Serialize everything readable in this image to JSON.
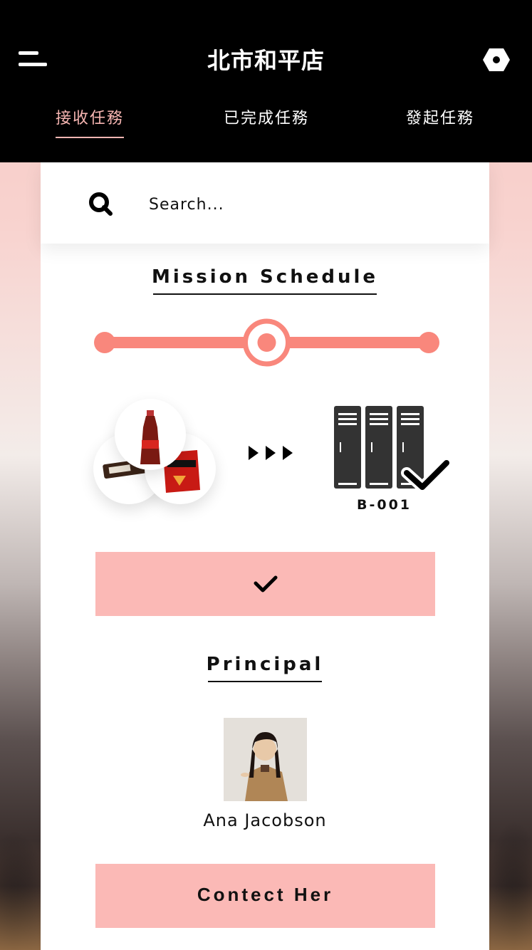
{
  "header": {
    "store_name": "北市和平店"
  },
  "tabs": [
    {
      "label": "接收任務",
      "active": true
    },
    {
      "label": "已完成任務",
      "active": false
    },
    {
      "label": "發起任務",
      "active": false
    }
  ],
  "search": {
    "placeholder": "Search..."
  },
  "mission": {
    "title": "Mission Schedule",
    "progress_value": 0.5,
    "locker_id": "B-001"
  },
  "principal": {
    "title": "Principal",
    "name": "Ana Jacobson",
    "contact_label": "Contect Her"
  },
  "colors": {
    "accent": "#fbb9b6",
    "slider": "#f9877c",
    "header_bg": "#000000",
    "card_bg": "#ffffff"
  },
  "icons": {
    "menu": "menu-icon",
    "settings": "settings-icon",
    "search": "search-icon",
    "check": "check-icon",
    "arrows": "forward-arrows-icon",
    "locker": "locker-icon"
  }
}
